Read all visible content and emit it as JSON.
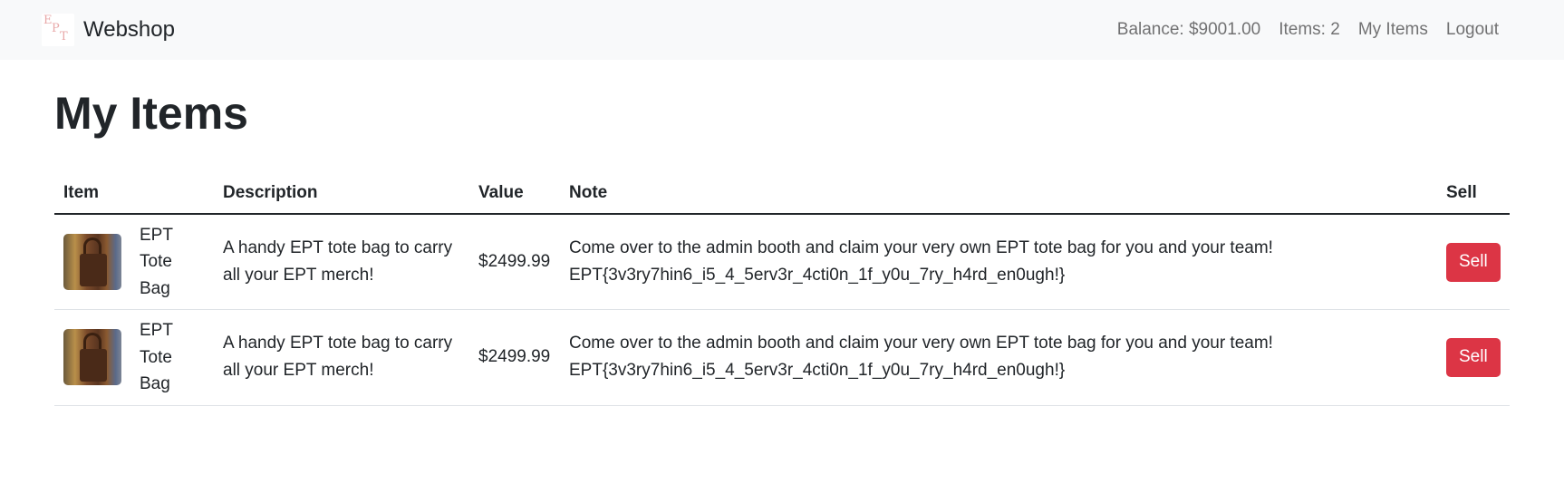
{
  "navbar": {
    "brand_logo_letters": [
      "E",
      "P",
      "T"
    ],
    "brand_name": "Webshop",
    "balance": "Balance: $9001.00",
    "items_count": "Items: 2",
    "my_items_link": "My Items",
    "logout_link": "Logout"
  },
  "page": {
    "title": "My Items"
  },
  "table": {
    "headers": {
      "item": "Item",
      "description": "Description",
      "value": "Value",
      "note": "Note",
      "sell": "Sell"
    },
    "rows": [
      {
        "item_name": "EPT Tote Bag",
        "description": "A handy EPT tote bag to carry all your EPT merch!",
        "value": "$2499.99",
        "note_line1": "Come over to the admin booth and claim your very own EPT tote bag for you and your team!",
        "note_line2": "EPT{3v3ry7hin6_i5_4_5erv3r_4cti0n_1f_y0u_7ry_h4rd_en0ugh!}",
        "sell_label": "Sell"
      },
      {
        "item_name": "EPT Tote Bag",
        "description": "A handy EPT tote bag to carry all your EPT merch!",
        "value": "$2499.99",
        "note_line1": "Come over to the admin booth and claim your very own EPT tote bag for you and your team!",
        "note_line2": "EPT{3v3ry7hin6_i5_4_5erv3r_4cti0n_1f_y0u_7ry_h4rd_en0ugh!}",
        "sell_label": "Sell"
      }
    ]
  },
  "colors": {
    "navbar_bg": "#f8f9fa",
    "sell_button": "#dc3545",
    "text": "#212529"
  }
}
